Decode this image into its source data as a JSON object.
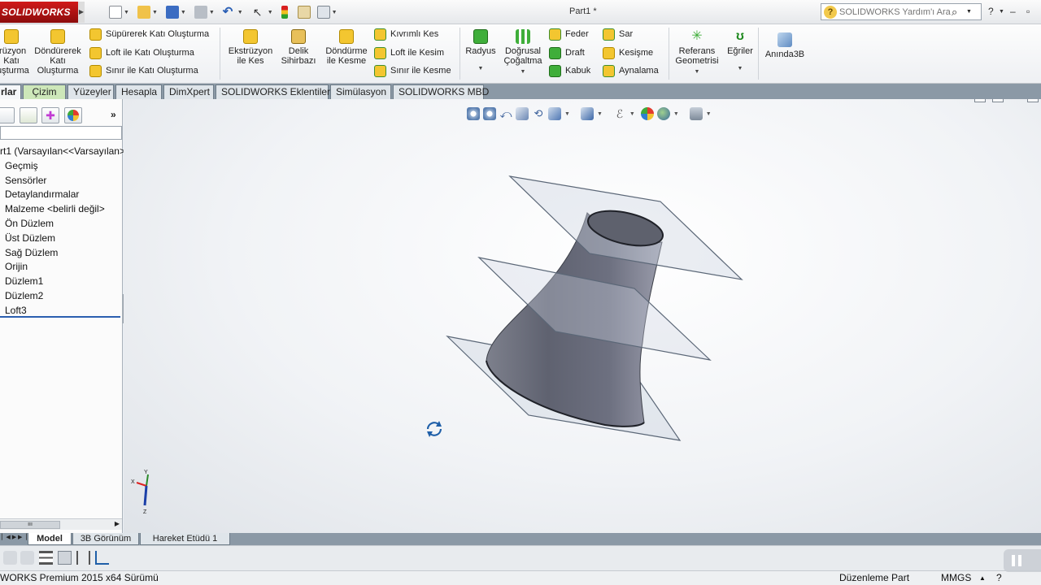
{
  "app": {
    "logo_text": "SOLIDWORKS",
    "document_title": "Part1 *",
    "help_search_placeholder": "SOLIDWORKS Yardım'ı Ara"
  },
  "quick_access": {
    "icons": [
      "new-document-icon",
      "open-folder-icon",
      "save-icon",
      "print-icon",
      "undo-icon",
      "select-icon",
      "rebuild-icon",
      "file-properties-icon",
      "options-icon"
    ]
  },
  "ribbon": {
    "extrude_label_l1": "trüzyon",
    "extrude_label_l2": "Katı",
    "extrude_label_l3": "uşturma",
    "revolve_l1": "Döndürerek",
    "revolve_l2": "Katı",
    "revolve_l3": "Oluşturma",
    "sweep": "Süpürerek Katı Oluşturma",
    "loft": "Loft ile Katı Oluşturma",
    "boundary": "Sınır ile Katı Oluşturma",
    "extruded_cut_l1": "Ekstrüzyon",
    "extruded_cut_l2": "ile Kes",
    "hole_wizard_l1": "Delik",
    "hole_wizard_l2": "Sihirbazı",
    "revolved_cut_l1": "Döndürme",
    "revolved_cut_l2": "ile Kesme",
    "swept_cut": "Kıvrımlı Kes",
    "lofted_cut": "Loft ile Kesim",
    "boundary_cut": "Sınır ile Kesme",
    "fillet": "Radyus",
    "linear_pattern_l1": "Doğrusal",
    "linear_pattern_l2": "Çoğaltma",
    "rib": "Feder",
    "draft": "Draft",
    "shell": "Kabuk",
    "wrap": "Sar",
    "intersect": "Kesişme",
    "mirror": "Aynalama",
    "ref_geometry_l1": "Referans",
    "ref_geometry_l2": "Geometrisi",
    "curves": "Eğriler",
    "instant3d": "Anında3B"
  },
  "command_tabs": [
    {
      "label": "rlar",
      "active": true
    },
    {
      "label": "Çizim"
    },
    {
      "label": "Yüzeyler"
    },
    {
      "label": "Hesapla"
    },
    {
      "label": "DimXpert"
    },
    {
      "label": "SOLIDWORKS Eklentileri"
    },
    {
      "label": "Simülasyon"
    },
    {
      "label": "SOLIDWORKS MBD"
    }
  ],
  "feature_tree": {
    "items": [
      {
        "label": "rt1  (Varsayılan<<Varsayılan>"
      },
      {
        "label": "Geçmiş"
      },
      {
        "label": "Sensörler"
      },
      {
        "label": "Detaylandırmalar"
      },
      {
        "label": "Malzeme <belirli değil>"
      },
      {
        "label": "Ön Düzlem"
      },
      {
        "label": "Üst Düzlem"
      },
      {
        "label": "Sağ Düzlem"
      },
      {
        "label": "Orijin"
      },
      {
        "label": "Düzlem1"
      },
      {
        "label": "Düzlem2"
      },
      {
        "label": "Loft3"
      }
    ]
  },
  "triad": {
    "x": "X",
    "y": "Y",
    "z": "Z"
  },
  "bottom_tabs": [
    "Model",
    "3B Görünüm",
    "Hareket Etüdü 1"
  ],
  "status": {
    "left": "WORKS Premium 2015 x64 Sürümü",
    "mode": "Düzenleme Part",
    "units": "MMGS",
    "help": "?"
  },
  "colors": {
    "logo_red": "#c41414",
    "tab_bar": "#8b99a6",
    "plane_fill": "#c6cfdc",
    "plane_edge": "#5b6777",
    "part_body": "#6b6e7a"
  }
}
